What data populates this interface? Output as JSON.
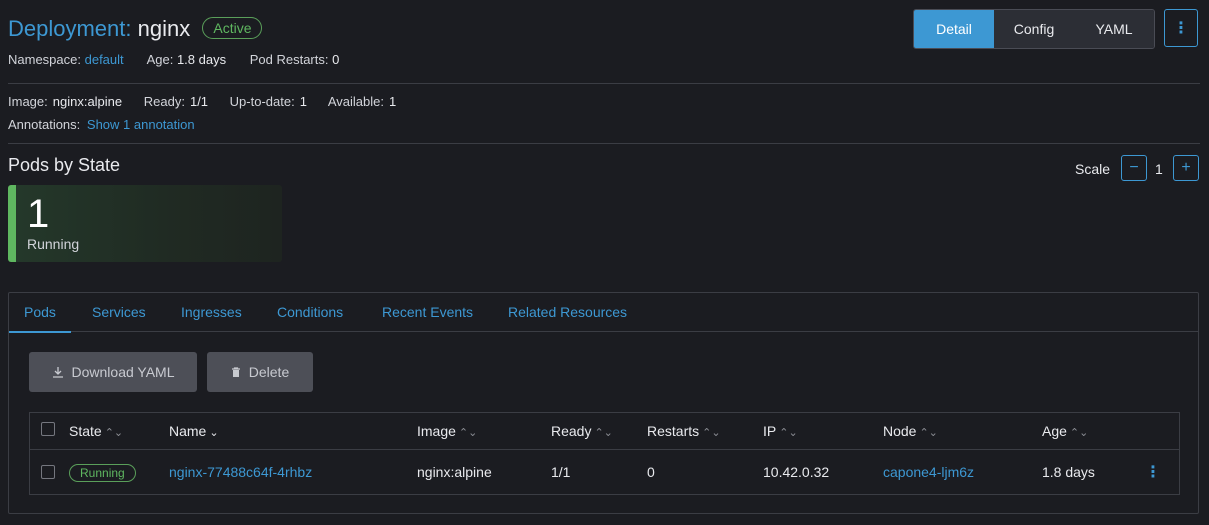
{
  "header": {
    "title_prefix": "Deployment:",
    "title_name": "nginx",
    "status": "Active",
    "namespace_label": "Namespace:",
    "namespace_value": "default",
    "age_label": "Age:",
    "age_value": "1.8 days",
    "restarts_label": "Pod Restarts:",
    "restarts_value": "0"
  },
  "view_toggle": {
    "options": [
      "Detail",
      "Config",
      "YAML"
    ],
    "selected": "Detail"
  },
  "details": {
    "image_label": "Image:",
    "image_value": "nginx:alpine",
    "ready_label": "Ready:",
    "ready_value": "1/1",
    "uptodate_label": "Up-to-date:",
    "uptodate_value": "1",
    "available_label": "Available:",
    "available_value": "1",
    "annotations_label": "Annotations:",
    "annotations_link": "Show 1 annotation"
  },
  "pods_by_state": {
    "title": "Pods by State",
    "count": "1",
    "state": "Running",
    "scale_label": "Scale",
    "scale_value": "1"
  },
  "tabs": [
    "Pods",
    "Services",
    "Ingresses",
    "Conditions",
    "Recent Events",
    "Related Resources"
  ],
  "actions": {
    "download": "Download YAML",
    "delete": "Delete"
  },
  "table": {
    "headers": [
      "State",
      "Name",
      "Image",
      "Ready",
      "Restarts",
      "IP",
      "Node",
      "Age"
    ],
    "rows": [
      {
        "state": "Running",
        "name": "nginx-77488c64f-4rhbz",
        "image": "nginx:alpine",
        "ready": "1/1",
        "restarts": "0",
        "ip": "10.42.0.32",
        "node": "capone4-ljm6z",
        "age": "1.8 days"
      }
    ]
  },
  "icons": {
    "kebab": "kebab-vertical-icon",
    "download": "download-icon",
    "delete": "trash-icon",
    "sort": "sort-icon"
  },
  "colors": {
    "accent": "#3d98d3",
    "success": "#5fb760",
    "background": "#1b1c21"
  }
}
